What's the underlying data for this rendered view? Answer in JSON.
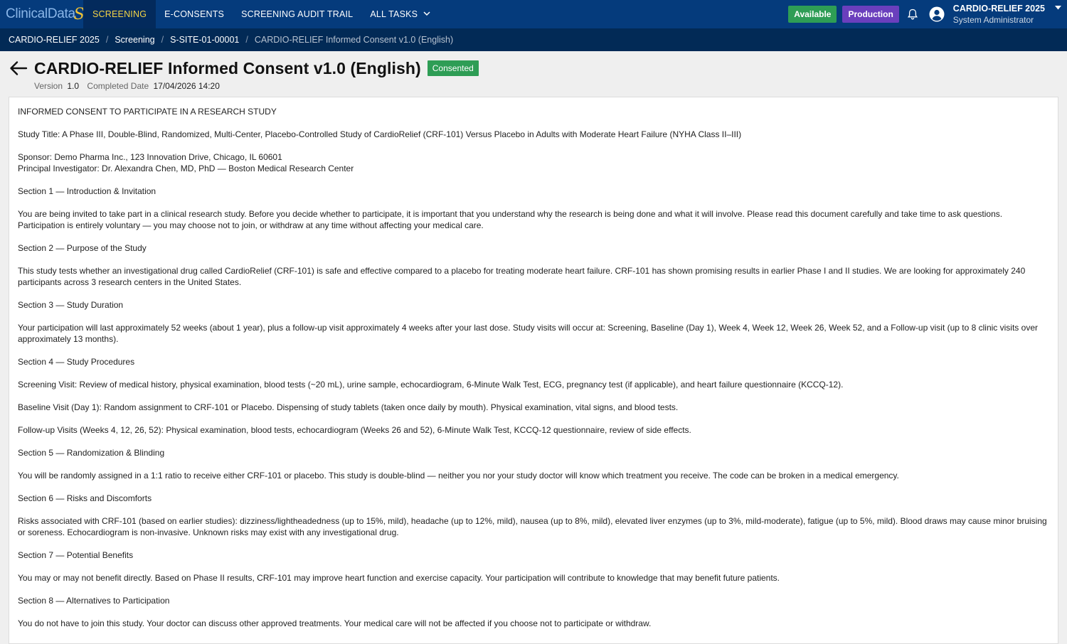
{
  "brand": {
    "logo_text": "ClinicalData",
    "logo_mark": "S"
  },
  "nav": {
    "items": [
      {
        "label": "SCREENING",
        "active": true
      },
      {
        "label": "E-CONSENTS"
      },
      {
        "label": "SCREENING AUDIT TRAIL"
      },
      {
        "label": "ALL TASKS"
      }
    ]
  },
  "status": {
    "available": "Available",
    "environment": "Production"
  },
  "icons": {
    "notifications": "bell-icon",
    "user": "user-circle-icon",
    "back": "arrow-left-icon",
    "menu_caret": "caret-down-icon",
    "nav_chevron": "chevron-down-icon"
  },
  "user": {
    "study": "CARDIO-RELIEF 2025",
    "role": "System Administrator"
  },
  "breadcrumb": [
    "CARDIO-RELIEF 2025",
    "Screening",
    "S-SITE-01-00001",
    "CARDIO-RELIEF Informed Consent v1.0 (English)"
  ],
  "header": {
    "title": "CARDIO-RELIEF Informed Consent v1.0 (English)",
    "status": "Consented",
    "version_label": "Version",
    "version": "1.0",
    "completed_label": "Completed Date",
    "completed": "17/04/2026 14:20"
  },
  "colors": {
    "nav_bg": "#053b7c",
    "breadcrumb_bg": "#022a56",
    "active_nav_text": "#f3d346",
    "consented": "#2e9d55",
    "production": "#6a3fbd"
  },
  "document": {
    "heading": "INFORMED CONSENT TO PARTICIPATE IN A RESEARCH STUDY",
    "study_title": "Study Title: A Phase III, Double-Blind, Randomized, Multi-Center, Placebo-Controlled Study of CardioRelief (CRF-101) Versus Placebo in Adults with Moderate Heart Failure (NYHA Class II–III)",
    "sponsor": "Sponsor: Demo Pharma Inc., 123 Innovation Drive, Chicago, IL 60601",
    "pi": "Principal Investigator: Dr. Alexandra Chen, MD, PhD — Boston Medical Research Center",
    "s1_title": "Section 1 — Introduction & Invitation",
    "s1_body": "You are being invited to take part in a clinical research study. Before you decide whether to participate, it is important that you understand why the research is being done and what it will involve. Please read this document carefully and take time to ask questions. Participation is entirely voluntary — you may choose not to join, or withdraw at any time without affecting your medical care.",
    "s2_title": "Section 2 — Purpose of the Study",
    "s2_body": "This study tests whether an investigational drug called CardioRelief (CRF-101) is safe and effective compared to a placebo for treating moderate heart failure. CRF-101 has shown promising results in earlier Phase I and II studies. We are looking for approximately 240 participants across 3 research centers in the United States.",
    "s3_title": "Section 3 — Study Duration",
    "s3_body": "Your participation will last approximately 52 weeks (about 1 year), plus a follow-up visit approximately 4 weeks after your last dose. Study visits will occur at: Screening, Baseline (Day 1), Week 4, Week 12, Week 26, Week 52, and a Follow-up visit (up to 8 clinic visits over approximately 13 months).",
    "s4_title": "Section 4 — Study Procedures",
    "s4_screening": "Screening Visit: Review of medical history, physical examination, blood tests (~20 mL), urine sample, echocardiogram, 6-Minute Walk Test, ECG, pregnancy test (if applicable), and heart failure questionnaire (KCCQ-12).",
    "s4_baseline": "Baseline Visit (Day 1): Random assignment to CRF-101 or Placebo. Dispensing of study tablets (taken once daily by mouth). Physical examination, vital signs, and blood tests.",
    "s4_followup": "Follow-up Visits (Weeks 4, 12, 26, 52): Physical examination, blood tests, echocardiogram (Weeks 26 and 52), 6-Minute Walk Test, KCCQ-12 questionnaire, review of side effects.",
    "s5_title": "Section 5 — Randomization & Blinding",
    "s5_body": "You will be randomly assigned in a 1:1 ratio to receive either CRF-101 or placebo. This study is double-blind — neither you nor your study doctor will know which treatment you receive. The code can be broken in a medical emergency.",
    "s6_title": "Section 6 — Risks and Discomforts",
    "s6_body": "Risks associated with CRF-101 (based on earlier studies): dizziness/lightheadedness (up to 15%, mild), headache (up to 12%, mild), nausea (up to 8%, mild), elevated liver enzymes (up to 3%, mild-moderate), fatigue (up to 5%, mild). Blood draws may cause minor bruising or soreness. Echocardiogram is non-invasive. Unknown risks may exist with any investigational drug.",
    "s7_title": "Section 7 — Potential Benefits",
    "s7_body": "You may or may not benefit directly. Based on Phase II results, CRF-101 may improve heart function and exercise capacity. Your participation will contribute to knowledge that may benefit future patients.",
    "s8_title": "Section 8 — Alternatives to Participation",
    "s8_body": "You do not have to join this study. Your doctor can discuss other approved treatments. Your medical care will not be affected if you choose not to participate or withdraw."
  }
}
